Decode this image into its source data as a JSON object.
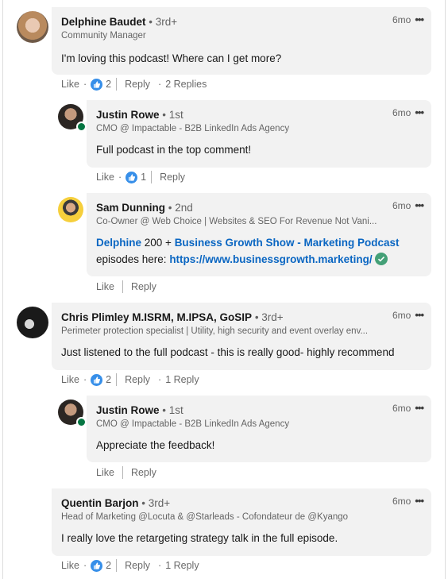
{
  "labels": {
    "like": "Like",
    "reply": "Reply",
    "more": "•••"
  },
  "colors": {
    "link": "#0a66c2",
    "reaction": "#378fe9",
    "bubble": "#f2f2f2",
    "online": "#057642",
    "verified": "#44a077"
  },
  "comments": [
    {
      "name": "Delphine Baudet",
      "degree": "• 3rd+",
      "headline": "Community Manager",
      "time": "6mo",
      "text": "I'm loving this podcast! Where can I get more?",
      "reactions": "2",
      "replies": "2 Replies",
      "avatar": "avatar-photo-woman"
    },
    {
      "name": "Justin Rowe",
      "degree": "• 1st",
      "headline": "CMO @ Impactable - B2B LinkedIn Ads Agency",
      "time": "6mo",
      "text": "Full podcast in the top comment!",
      "reactions": "1",
      "online": true,
      "avatar": "avatar-photo-man"
    },
    {
      "name": "Sam Dunning",
      "degree": "• 2nd",
      "headline": "Co-Owner @ Web Choice | Websites & SEO For Revenue Not Vani...",
      "time": "6mo",
      "text_parts": {
        "mention": "Delphine",
        "plain1": " 200 + ",
        "page_link": "Business Growth Show - Marketing Podcast",
        "plain2": "episodes here: ",
        "url": "https://www.businessgrowth.marketing/"
      },
      "avatar": "avatar-photo-man-yellow",
      "verified_icon": "check-circle-icon"
    },
    {
      "name": "Chris Plimley M.ISRM, M.IPSA, GoSIP",
      "degree": "• 3rd+",
      "headline": "Perimeter protection specialist | Utility, high security and event overlay env...",
      "time": "6mo",
      "text": "Just listened to the full podcast - this is really good- highly recommend",
      "reactions": "2",
      "replies": "1 Reply",
      "avatar": "avatar-photo-man-bw"
    },
    {
      "name": "Justin Rowe",
      "degree": "• 1st",
      "headline": "CMO @ Impactable - B2B LinkedIn Ads Agency",
      "time": "6mo",
      "text": "Appreciate the feedback!",
      "online": true,
      "avatar": "avatar-photo-man"
    },
    {
      "name": "Quentin Barjon",
      "degree": "• 3rd+",
      "headline": "Head of Marketing @Locuta & @Starleads - Cofondateur de @Kyango",
      "time": "6mo",
      "text": "I really love the retargeting strategy talk in the full episode.",
      "reactions": "2",
      "replies": "1 Reply"
    }
  ]
}
